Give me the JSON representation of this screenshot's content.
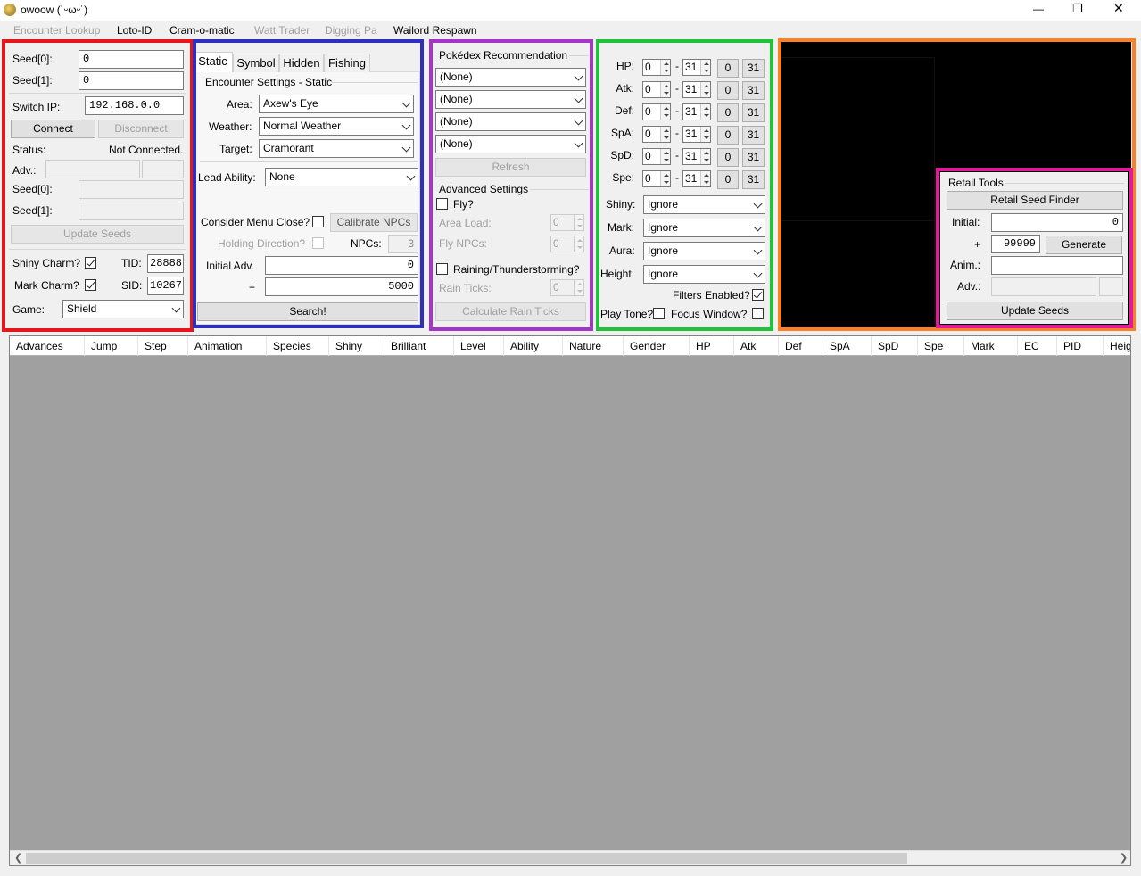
{
  "window": {
    "title": "owoow (˙ᵕωᵕ˙)",
    "controls": {
      "minimize": "—",
      "maximize": "❐",
      "close": "✕"
    }
  },
  "menu": {
    "items": [
      "Encounter Lookup",
      "Loto-ID",
      "Cram-o-matic",
      "Watt Trader",
      "Digging Pa",
      "Wailord Respawn"
    ]
  },
  "connection": {
    "seed0_label": "Seed[0]:",
    "seed0_value": "0",
    "seed1_label": "Seed[1]:",
    "seed1_value": "0",
    "switch_ip_label": "Switch IP:",
    "switch_ip_value": "192.168.0.0",
    "connect": "Connect",
    "disconnect": "Disconnect",
    "status_label": "Status:",
    "status_value": "Not Connected.",
    "adv_label": "Adv.:",
    "adv_value": "",
    "adv_extra": "",
    "cur_seed0_label": "Seed[0]:",
    "cur_seed0_value": "",
    "cur_seed1_label": "Seed[1]:",
    "cur_seed1_value": "",
    "update_seeds": "Update Seeds",
    "shiny_charm_label": "Shiny Charm?",
    "shiny_charm": true,
    "mark_charm_label": "Mark Charm?",
    "mark_charm": true,
    "tid_label": "TID:",
    "tid_value": "28888",
    "sid_label": "SID:",
    "sid_value": "10267",
    "game_label": "Game:",
    "game_value": "Shield"
  },
  "encounter": {
    "tabs": [
      "Static",
      "Symbol",
      "Hidden",
      "Fishing"
    ],
    "active_tab": 0,
    "group_title": "Encounter Settings - Static",
    "area_label": "Area:",
    "area_value": "Axew's Eye",
    "weather_label": "Weather:",
    "weather_value": "Normal Weather",
    "target_label": "Target:",
    "target_value": "Cramorant",
    "lead_label": "Lead Ability:",
    "lead_value": "None",
    "menu_close_label": "Consider Menu Close?",
    "menu_close": false,
    "calibrate": "Calibrate NPCs",
    "holding_label": "Holding Direction?",
    "holding": false,
    "npcs_label": "NPCs:",
    "npcs_value": "3",
    "initial_label": "Initial Adv.",
    "initial_value": "0",
    "plus_label": "+",
    "plus_value": "5000",
    "search": "Search!"
  },
  "pokedex": {
    "group_title": "Pokédex Recommendation",
    "selects": [
      "(None)",
      "(None)",
      "(None)",
      "(None)"
    ],
    "refresh": "Refresh",
    "adv_title": "Advanced Settings",
    "fly_label": "Fly?",
    "fly": false,
    "area_load_label": "Area Load:",
    "area_load_value": "0",
    "fly_npcs_label": "Fly NPCs:",
    "fly_npcs_value": "0",
    "raining_label": "Raining/Thunderstorming?",
    "raining": false,
    "rain_ticks_label": "Rain Ticks:",
    "rain_ticks_value": "0",
    "calc_rain": "Calculate Rain Ticks"
  },
  "filters": {
    "ivs": [
      {
        "label": "HP:",
        "min": "0",
        "max": "31"
      },
      {
        "label": "Atk:",
        "min": "0",
        "max": "31"
      },
      {
        "label": "Def:",
        "min": "0",
        "max": "31"
      },
      {
        "label": "SpA:",
        "min": "0",
        "max": "31"
      },
      {
        "label": "SpD:",
        "min": "0",
        "max": "31"
      },
      {
        "label": "Spe:",
        "min": "0",
        "max": "31"
      }
    ],
    "dash": "-",
    "btn_min": "0",
    "btn_max": "31",
    "shiny_label": "Shiny:",
    "shiny_value": "Ignore",
    "mark_label": "Mark:",
    "mark_value": "Ignore",
    "aura_label": "Aura:",
    "aura_value": "Ignore",
    "height_label": "Height:",
    "height_value": "Ignore",
    "filters_enabled_label": "Filters Enabled?",
    "filters_enabled": true,
    "play_tone_label": "Play Tone?",
    "play_tone": false,
    "focus_window_label": "Focus Window?",
    "focus_window": false
  },
  "retail": {
    "group_title": "Retail Tools",
    "seed_finder": "Retail Seed Finder",
    "initial_label": "Initial:",
    "initial_value": "0",
    "plus_label": "+",
    "plus_value": "99999",
    "generate": "Generate",
    "anim_label": "Anim.:",
    "anim_value": "",
    "adv_label": "Adv.:",
    "adv_value": "",
    "adv_extra": "",
    "update_seeds": "Update Seeds"
  },
  "results": {
    "columns": [
      "Advances",
      "Jump",
      "Step",
      "Animation",
      "Species",
      "Shiny",
      "Brilliant",
      "Level",
      "Ability",
      "Nature",
      "Gender",
      "HP",
      "Atk",
      "Def",
      "SpA",
      "SpD",
      "Spe",
      "Mark",
      "EC",
      "PID",
      "Height"
    ],
    "rows": []
  },
  "highlight_colors": {
    "connection": "#e8141c",
    "encounter": "#2f2fbf",
    "pokedex": "#a335c9",
    "filters": "#22c13a",
    "preview": "#ff7f27",
    "retail": "#e5179b"
  }
}
